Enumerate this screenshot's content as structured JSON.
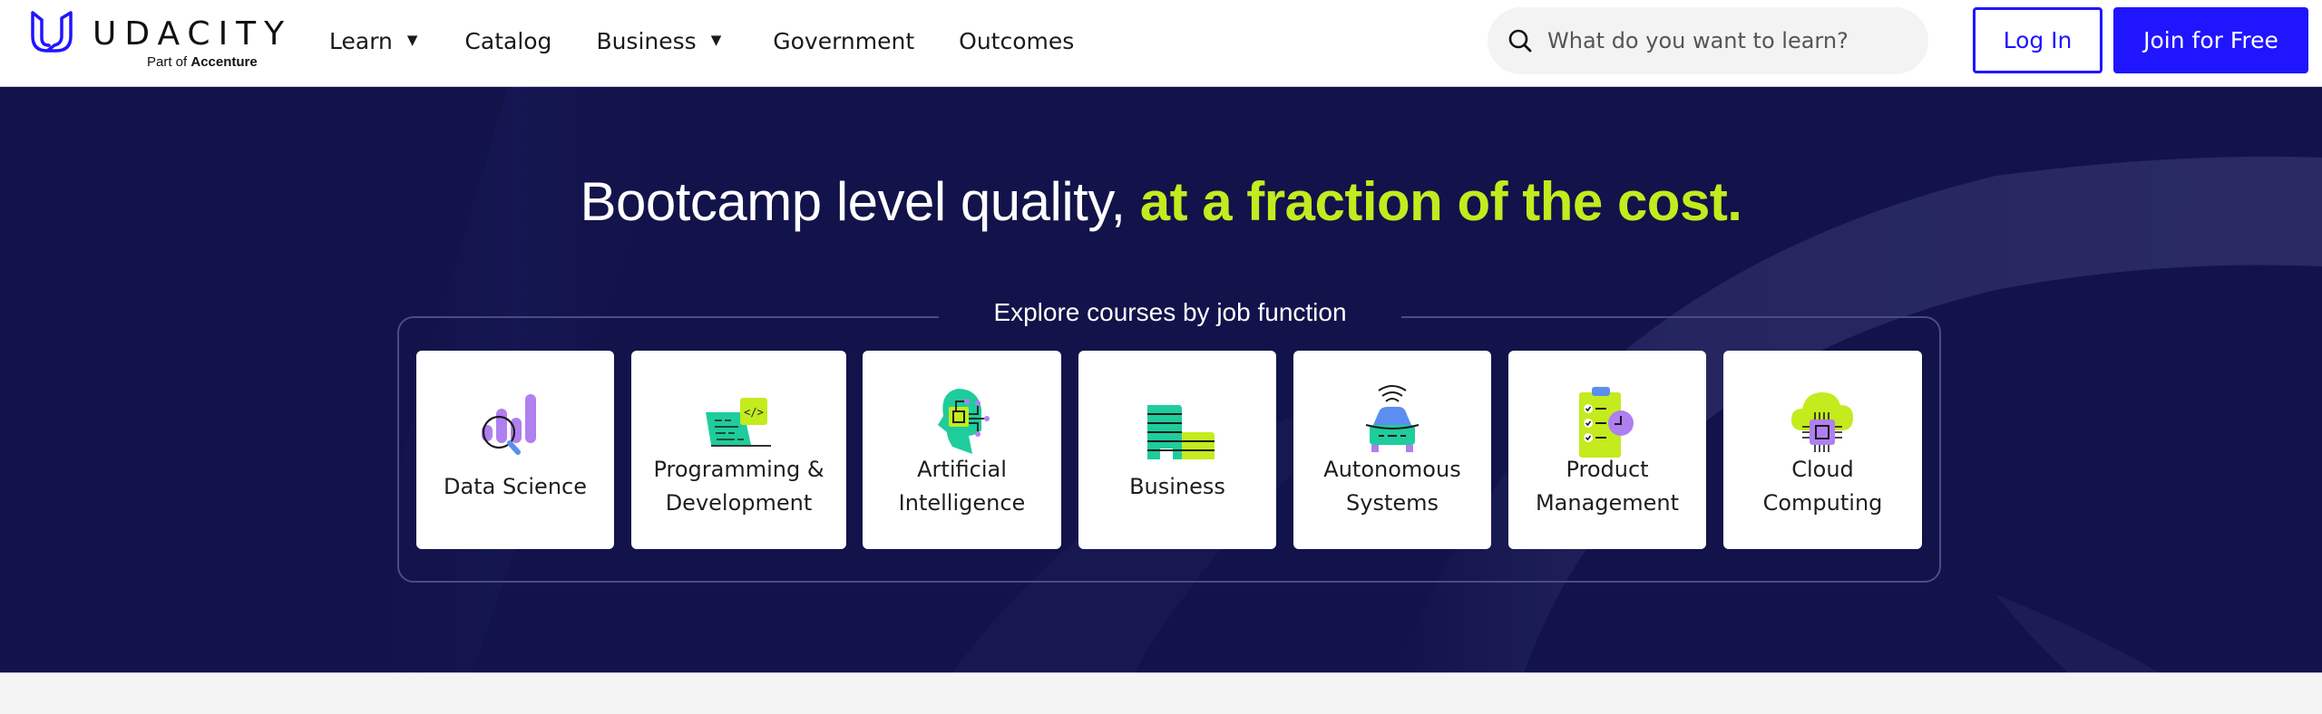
{
  "header": {
    "logo": {
      "wordmark": "UDACITY",
      "sub_prefix": "Part of",
      "sub_brand": "Accenture",
      "color": "#2015ff"
    },
    "nav": [
      {
        "label": "Learn",
        "has_dropdown": true
      },
      {
        "label": "Catalog",
        "has_dropdown": false
      },
      {
        "label": "Business",
        "has_dropdown": true
      },
      {
        "label": "Government",
        "has_dropdown": false
      },
      {
        "label": "Outcomes",
        "has_dropdown": false
      }
    ],
    "caret_glyph": "▼",
    "search": {
      "placeholder": "What do you want to learn?",
      "value": "",
      "icon": "search-icon"
    },
    "login_label": "Log In",
    "join_label": "Join for Free"
  },
  "hero": {
    "title_plain": "Bootcamp level quality, ",
    "title_accent": "at a fraction of the cost.",
    "explore_label": "Explore courses by job function",
    "colors": {
      "background": "#12134a",
      "accent": "#c3eb1e"
    },
    "categories": [
      {
        "label_line1": "Data Science",
        "label_line2": "",
        "icon": "data-science-icon"
      },
      {
        "label_line1": "Programming &",
        "label_line2": "Development",
        "icon": "programming-icon"
      },
      {
        "label_line1": "Artificial",
        "label_line2": "Intelligence",
        "icon": "ai-head-icon"
      },
      {
        "label_line1": "Business",
        "label_line2": "",
        "icon": "business-building-icon"
      },
      {
        "label_line1": "Autonomous",
        "label_line2": "Systems",
        "icon": "autonomous-car-icon"
      },
      {
        "label_line1": "Product",
        "label_line2": "Management",
        "icon": "product-clipboard-icon"
      },
      {
        "label_line1": "Cloud",
        "label_line2": "Computing",
        "icon": "cloud-chip-icon"
      }
    ]
  }
}
